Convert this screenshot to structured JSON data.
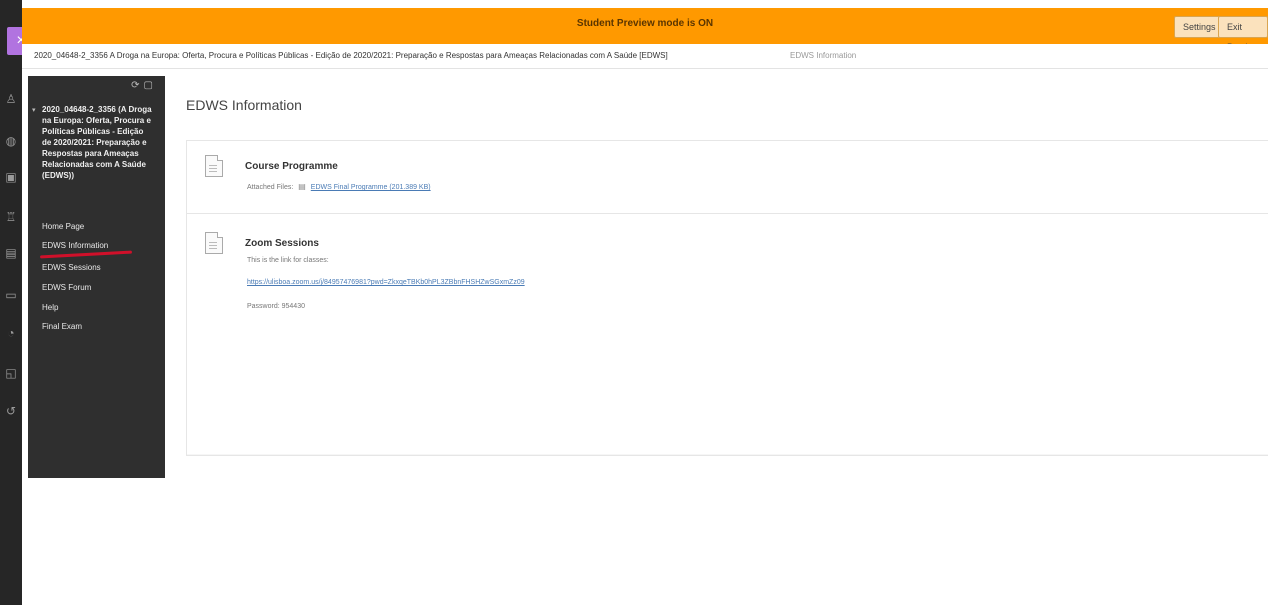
{
  "preview_bar": {
    "text": "Student Preview mode is ON",
    "settings_label": "Settings",
    "exit_label": "Exit Preview"
  },
  "rail": {
    "close_label": "×"
  },
  "breadcrumb": {
    "course": "2020_04648-2_3356 A Droga na Europa: Oferta, Procura e Políticas Públicas - Edição de 2020/2021: Preparação e Respostas para Ameaças Relacionadas com A Saúde [EDWS]",
    "current": "EDWS Information"
  },
  "course_menu": {
    "title": "2020_04648-2_3356 (A Droga na Europa: Oferta, Procura e Políticas Públicas - Edição de 2020/2021: Preparação e Respostas para Ameaças Relacionadas com A Saúde (EDWS))",
    "items": [
      {
        "label": "Home Page"
      },
      {
        "label": "EDWS Information"
      },
      {
        "label": "EDWS Sessions"
      },
      {
        "label": "EDWS Forum"
      },
      {
        "label": "Help"
      },
      {
        "label": "Final Exam"
      }
    ]
  },
  "content": {
    "title": "EDWS Information",
    "items": [
      {
        "title": "Course Programme",
        "attached_label": "Attached Files:",
        "file_link": "EDWS Final Programme (201.389 KB)"
      },
      {
        "title": "Zoom Sessions",
        "line1": "This is the link for classes:",
        "zoom_link": "https://ulisboa.zoom.us/j/84957476981?pwd=ZkxqeTBKb0hPL3ZBbnFHSHZwSGxmZz09",
        "password": "Password: 954430"
      }
    ]
  }
}
